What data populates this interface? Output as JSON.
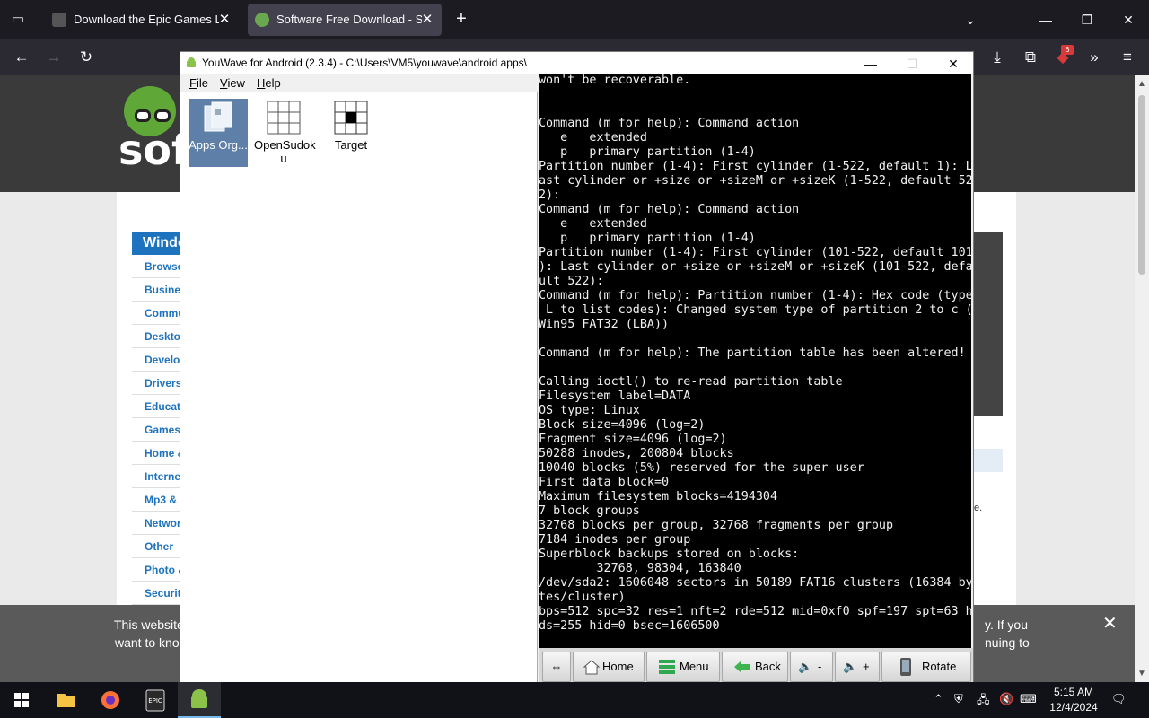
{
  "browser": {
    "tabs": [
      {
        "title": "Download the Epic Games Laun",
        "active": false
      },
      {
        "title": "Software Free Download - Soft",
        "active": true
      }
    ],
    "extension_badge": "6"
  },
  "webpage": {
    "logo_text": "soft",
    "category_heading": "Windo",
    "categories": [
      "Browse",
      "Busines",
      "Commu",
      "Deskto",
      "Develo",
      "Drivers",
      "Educati",
      "Games",
      "Home &",
      "Interne",
      "Mp3 &",
      "Networ",
      "Other",
      "Photo &",
      "Securit"
    ],
    "right_note": "te.",
    "cookie_banner": {
      "line1": "This website",
      "line2": "want to kno",
      "line1_right": "y. If you",
      "line2_right": "nuing to"
    }
  },
  "youwave": {
    "title": "YouWave for Android (2.3.4) - C:\\Users\\VM5\\youwave\\android apps\\",
    "menu": [
      "File",
      "View",
      "Help"
    ],
    "apps": [
      {
        "label": "Apps Org...",
        "selected": true
      },
      {
        "label": "OpenSudoku",
        "label_line2": "u",
        "label_line1": "OpenSudok"
      },
      {
        "label": "Target"
      }
    ],
    "terminal_lines": [
      "won't be recoverable.",
      "",
      "",
      "Command (m for help): Command action",
      "   e   extended",
      "   p   primary partition (1-4)",
      "Partition number (1-4): First cylinder (1-522, default 1): L",
      "ast cylinder or +size or +sizeM or +sizeK (1-522, default 52",
      "2):",
      "Command (m for help): Command action",
      "   e   extended",
      "   p   primary partition (1-4)",
      "Partition number (1-4): First cylinder (101-522, default 101",
      "): Last cylinder or +size or +sizeM or +sizeK (101-522, defa",
      "ult 522):",
      "Command (m for help): Partition number (1-4): Hex code (type",
      " L to list codes): Changed system type of partition 2 to c (",
      "Win95 FAT32 (LBA))",
      "",
      "Command (m for help): The partition table has been altered!",
      "",
      "Calling ioctl() to re-read partition table",
      "Filesystem label=DATA",
      "OS type: Linux",
      "Block size=4096 (log=2)",
      "Fragment size=4096 (log=2)",
      "50288 inodes, 200804 blocks",
      "10040 blocks (5%) reserved for the super user",
      "First data block=0",
      "Maximum filesystem blocks=4194304",
      "7 block groups",
      "32768 blocks per group, 32768 fragments per group",
      "7184 inodes per group",
      "Superblock backups stored on blocks:",
      "        32768, 98304, 163840",
      "/dev/sda2: 1606048 sectors in 50189 FAT16 clusters (16384 by",
      "tes/cluster)",
      "bps=512 spc=32 res=1 nft=2 rde=512 mid=0xf0 spf=197 spt=63 h",
      "ds=255 hid=0 bsec=1606500"
    ],
    "controls": {
      "home": "Home",
      "menu": "Menu",
      "back": "Back",
      "vol_down": "-",
      "vol_up": "+",
      "rotate": "Rotate"
    }
  },
  "taskbar": {
    "time": "5:15 AM",
    "date": "12/4/2024"
  },
  "colors": {
    "browser_tabstrip": "#1c1b22",
    "browser_toolbar": "#2b2a33",
    "site_blue": "#1e73be",
    "selection": "#5e7fa8",
    "terminal_bg": "#000000"
  }
}
